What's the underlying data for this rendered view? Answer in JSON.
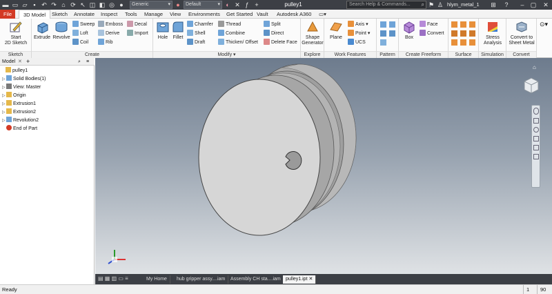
{
  "app": {
    "doc_title": "pulley1",
    "material": "Generic",
    "appearance": "Default",
    "search_placeholder": "Search Help & Commands...",
    "user": "hlym_metal_1"
  },
  "tabs": [
    "File",
    "3D Model",
    "Sketch",
    "Annotate",
    "Inspect",
    "Tools",
    "Manage",
    "View",
    "Environments",
    "Get Started",
    "Vault",
    "Autodesk A360"
  ],
  "active_tab": "3D Model",
  "ribbon": {
    "sketch": {
      "label": "Sketch",
      "start_sketch": "Start\n2D Sketch"
    },
    "create": {
      "label": "Create",
      "extrude": "Extrude",
      "revolve": "Revolve",
      "sweep": "Sweep",
      "loft": "Loft",
      "coil": "Coil",
      "emboss": "Emboss",
      "derive": "Derive",
      "rib": "Rib",
      "decal": "Decal",
      "import": "Import"
    },
    "modify": {
      "label": "Modify",
      "hole": "Hole",
      "fillet": "Fillet",
      "chamfer": "Chamfer",
      "shell": "Shell",
      "draft": "Draft",
      "thread": "Thread",
      "combine": "Combine",
      "thicken": "Thicken/ Offset",
      "split": "Split",
      "direct": "Direct",
      "delete_face": "Delete Face"
    },
    "explore": {
      "label": "Explore",
      "shape_generator": "Shape\nGenerator"
    },
    "work_features": {
      "label": "Work Features",
      "plane": "Plane",
      "axis": "Axis",
      "point": "Point",
      "ucs": "UCS"
    },
    "pattern": {
      "label": "Pattern"
    },
    "freeform": {
      "label": "Create Freeform",
      "box": "Box",
      "face": "Face",
      "convert": "Convert"
    },
    "surface": {
      "label": "Surface"
    },
    "simulation": {
      "label": "Simulation",
      "stress": "Stress\nAnalysis"
    },
    "convert": {
      "label": "Convert",
      "sheet_metal": "Convert to\nSheet Metal"
    }
  },
  "browser": {
    "tab": "Model",
    "add": "+",
    "items": [
      {
        "label": "pulley1",
        "level": 0,
        "expander": ""
      },
      {
        "label": "Solid Bodies(1)",
        "level": 1,
        "expander": "▷"
      },
      {
        "label": "View: Master",
        "level": 1,
        "expander": "▷"
      },
      {
        "label": "Origin",
        "level": 1,
        "expander": "▷"
      },
      {
        "label": "Extrusion1",
        "level": 1,
        "expander": "▷"
      },
      {
        "label": "Extrusion2",
        "level": 1,
        "expander": "▷"
      },
      {
        "label": "Revolution2",
        "level": 1,
        "expander": "▷"
      },
      {
        "label": "End of Part",
        "level": 1,
        "expander": ""
      }
    ]
  },
  "doc_tabs": [
    "My Home",
    "hub gripper assy....iam",
    "Assembly CH sta....iam",
    "pulley1.ipt"
  ],
  "active_doc_tab": "pulley1.ipt",
  "status": {
    "text": "Ready",
    "count1": "1",
    "count2": "90"
  },
  "colors": {
    "accent": "#d33a25",
    "titlebar": "#3c3f45"
  }
}
